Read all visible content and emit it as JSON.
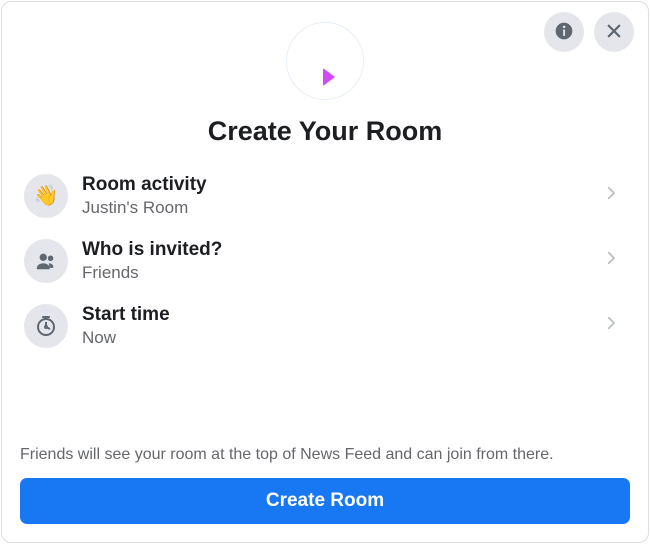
{
  "header": {
    "title": "Create Your Room"
  },
  "icons": {
    "info": "info-icon",
    "close": "close-icon",
    "hero": "video-plus-icon"
  },
  "rows": [
    {
      "icon": "wave-icon",
      "emoji": "👋",
      "title": "Room activity",
      "subtitle": "Justin's Room"
    },
    {
      "icon": "people-icon",
      "emoji": "",
      "title": "Who is invited?",
      "subtitle": "Friends"
    },
    {
      "icon": "clock-icon",
      "emoji": "",
      "title": "Start time",
      "subtitle": "Now"
    }
  ],
  "footer": {
    "note": "Friends will see your room at the top of News Feed and can join from there.",
    "button_label": "Create Room"
  }
}
